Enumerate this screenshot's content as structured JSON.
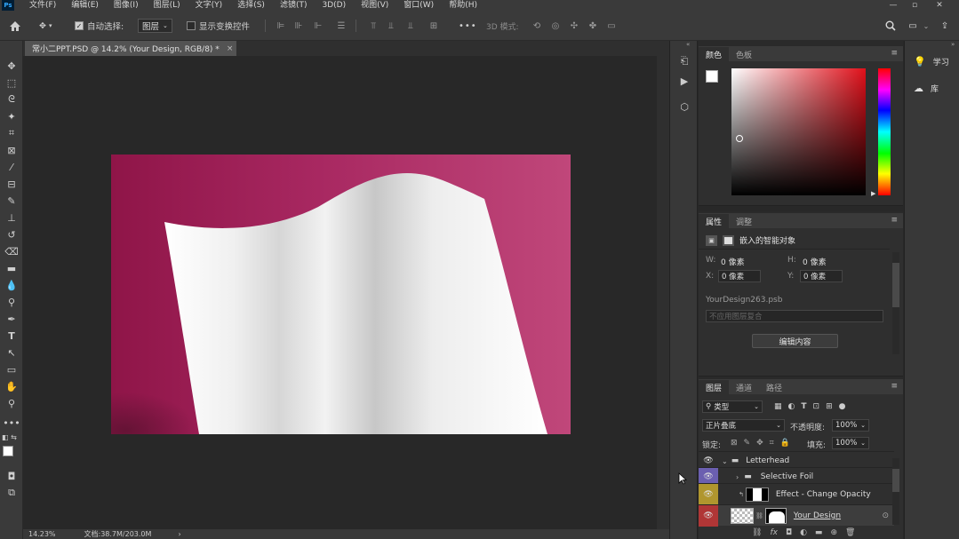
{
  "app": {
    "logo": "Ps"
  },
  "menu": {
    "items": [
      "文件(F)",
      "编辑(E)",
      "图像(I)",
      "图层(L)",
      "文字(Y)",
      "选择(S)",
      "滤镜(T)",
      "3D(D)",
      "视图(V)",
      "窗口(W)",
      "帮助(H)"
    ]
  },
  "options": {
    "auto_select_label": "自动选择:",
    "auto_select_value": "图层",
    "show_transform_label": "显示变换控件",
    "mode_3d_label": "3D 模式:",
    "more": "•••"
  },
  "document": {
    "tab_title": "常小二PPT.PSD @ 14.2% (Your Design, RGB/8) *",
    "close": "×",
    "zoom": "14.23%",
    "doc_info": "文档:38.7M/203.0M",
    "arrow": "›",
    "canvas_bg": "#b5346b",
    "paper_color": "#f4f4f4"
  },
  "color_panel": {
    "tabs": [
      "颜色",
      "色板"
    ],
    "fg": "#ffffff",
    "bg": "#ffffff"
  },
  "properties_panel": {
    "tabs": [
      "属性",
      "调整"
    ],
    "object_type": "嵌入的智能对象",
    "w_label": "W:",
    "w_value": "0 像素",
    "h_label": "H:",
    "h_value": "0 像素",
    "x_label": "X:",
    "x_value": "0 像素",
    "y_label": "Y:",
    "y_value": "0 像素",
    "filename": "YourDesign263.psb",
    "comp_placeholder": "不应用图层复合",
    "edit_button": "编辑内容"
  },
  "layers_panel": {
    "tabs": [
      "图层",
      "通道",
      "路径"
    ],
    "filter": "类型",
    "blend_mode": "正片叠底",
    "opacity_label": "不透明度:",
    "opacity_value": "100%",
    "lock_label": "锁定:",
    "fill_label": "填充:",
    "fill_value": "100%",
    "layers": [
      {
        "name": "Letterhead",
        "tag_color": "none",
        "kind": "group"
      },
      {
        "name": "Selective Foil",
        "tag_color": "#6b5fb0",
        "kind": "group"
      },
      {
        "name": "Effect - Change Opacity",
        "tag_color": "#b0962e",
        "kind": "layer"
      },
      {
        "name": "Your Design",
        "tag_color": "#b03636",
        "kind": "smart"
      }
    ]
  },
  "far_right": {
    "items": [
      "学习",
      "库"
    ]
  },
  "icons": {
    "move": "move-icon",
    "home": "home-icon",
    "search": "search-icon"
  }
}
